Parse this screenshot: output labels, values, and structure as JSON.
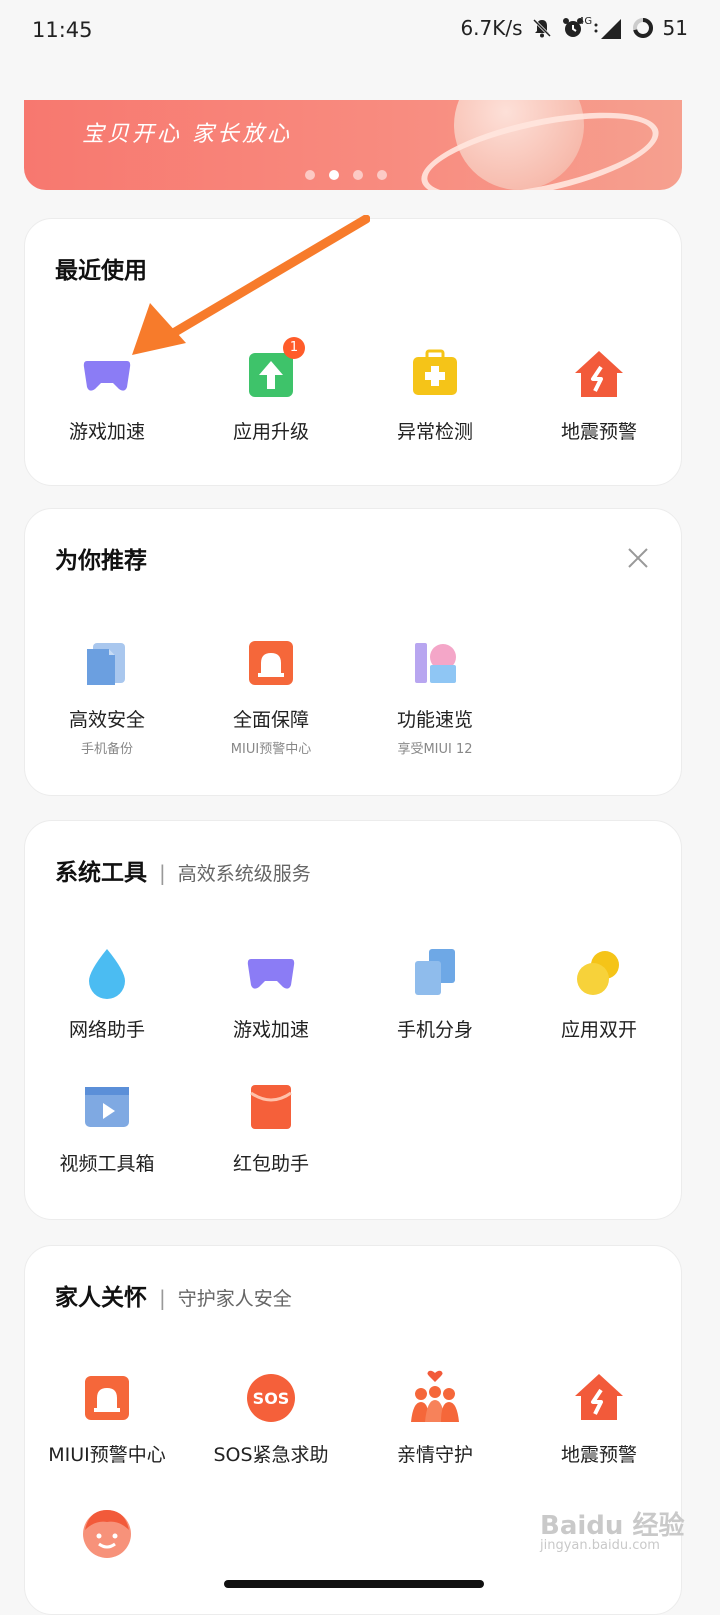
{
  "status": {
    "time": "11:45",
    "speed": "6.7K/s",
    "network": "4G",
    "battery": "51"
  },
  "banner": {
    "slogan": "宝贝开心 家长放心",
    "page_count": 4,
    "active_page": 2
  },
  "recent": {
    "title": "最近使用",
    "items": [
      {
        "label": "游戏加速",
        "icon": "gamepad-icon"
      },
      {
        "label": "应用升级",
        "icon": "upgrade-icon",
        "badge": "1"
      },
      {
        "label": "异常检测",
        "icon": "firstaid-icon"
      },
      {
        "label": "地震预警",
        "icon": "earthquake-house-icon"
      }
    ]
  },
  "recommend": {
    "title": "为你推荐",
    "items": [
      {
        "label": "高效安全",
        "sub": "手机备份",
        "icon": "backup-icon"
      },
      {
        "label": "全面保障",
        "sub": "MIUI预警中心",
        "icon": "alarm-icon"
      },
      {
        "label": "功能速览",
        "sub": "享受MIUI 12",
        "icon": "miui12-icon"
      }
    ]
  },
  "tools": {
    "title": "系统工具",
    "subtitle": "高效系统级服务",
    "items": [
      {
        "label": "网络助手",
        "icon": "waterdrop-icon"
      },
      {
        "label": "游戏加速",
        "icon": "gamepad-icon"
      },
      {
        "label": "手机分身",
        "icon": "dual-phone-icon"
      },
      {
        "label": "应用双开",
        "icon": "dual-app-icon"
      },
      {
        "label": "视频工具箱",
        "icon": "video-toolbox-icon"
      },
      {
        "label": "红包助手",
        "icon": "red-envelope-icon"
      }
    ]
  },
  "family": {
    "title": "家人关怀",
    "subtitle": "守护家人安全",
    "items": [
      {
        "label": "MIUI预警中心",
        "icon": "alarm-icon"
      },
      {
        "label": "SOS紧急求助",
        "icon": "sos-icon",
        "glyph": "SOS"
      },
      {
        "label": "亲情守护",
        "icon": "family-icon"
      },
      {
        "label": "地震预警",
        "icon": "earthquake-house-icon"
      }
    ]
  },
  "watermark": {
    "brand": "Baidu 经验",
    "url": "jingyan.baidu.com"
  },
  "colors": {
    "accent_orange": "#f77b2b",
    "banner": "#f7786f",
    "purple": "#8b7cf5",
    "green": "#3ec36a",
    "yellow": "#f5c418",
    "red_orange": "#f25a3a",
    "blue": "#4aa8f0"
  }
}
